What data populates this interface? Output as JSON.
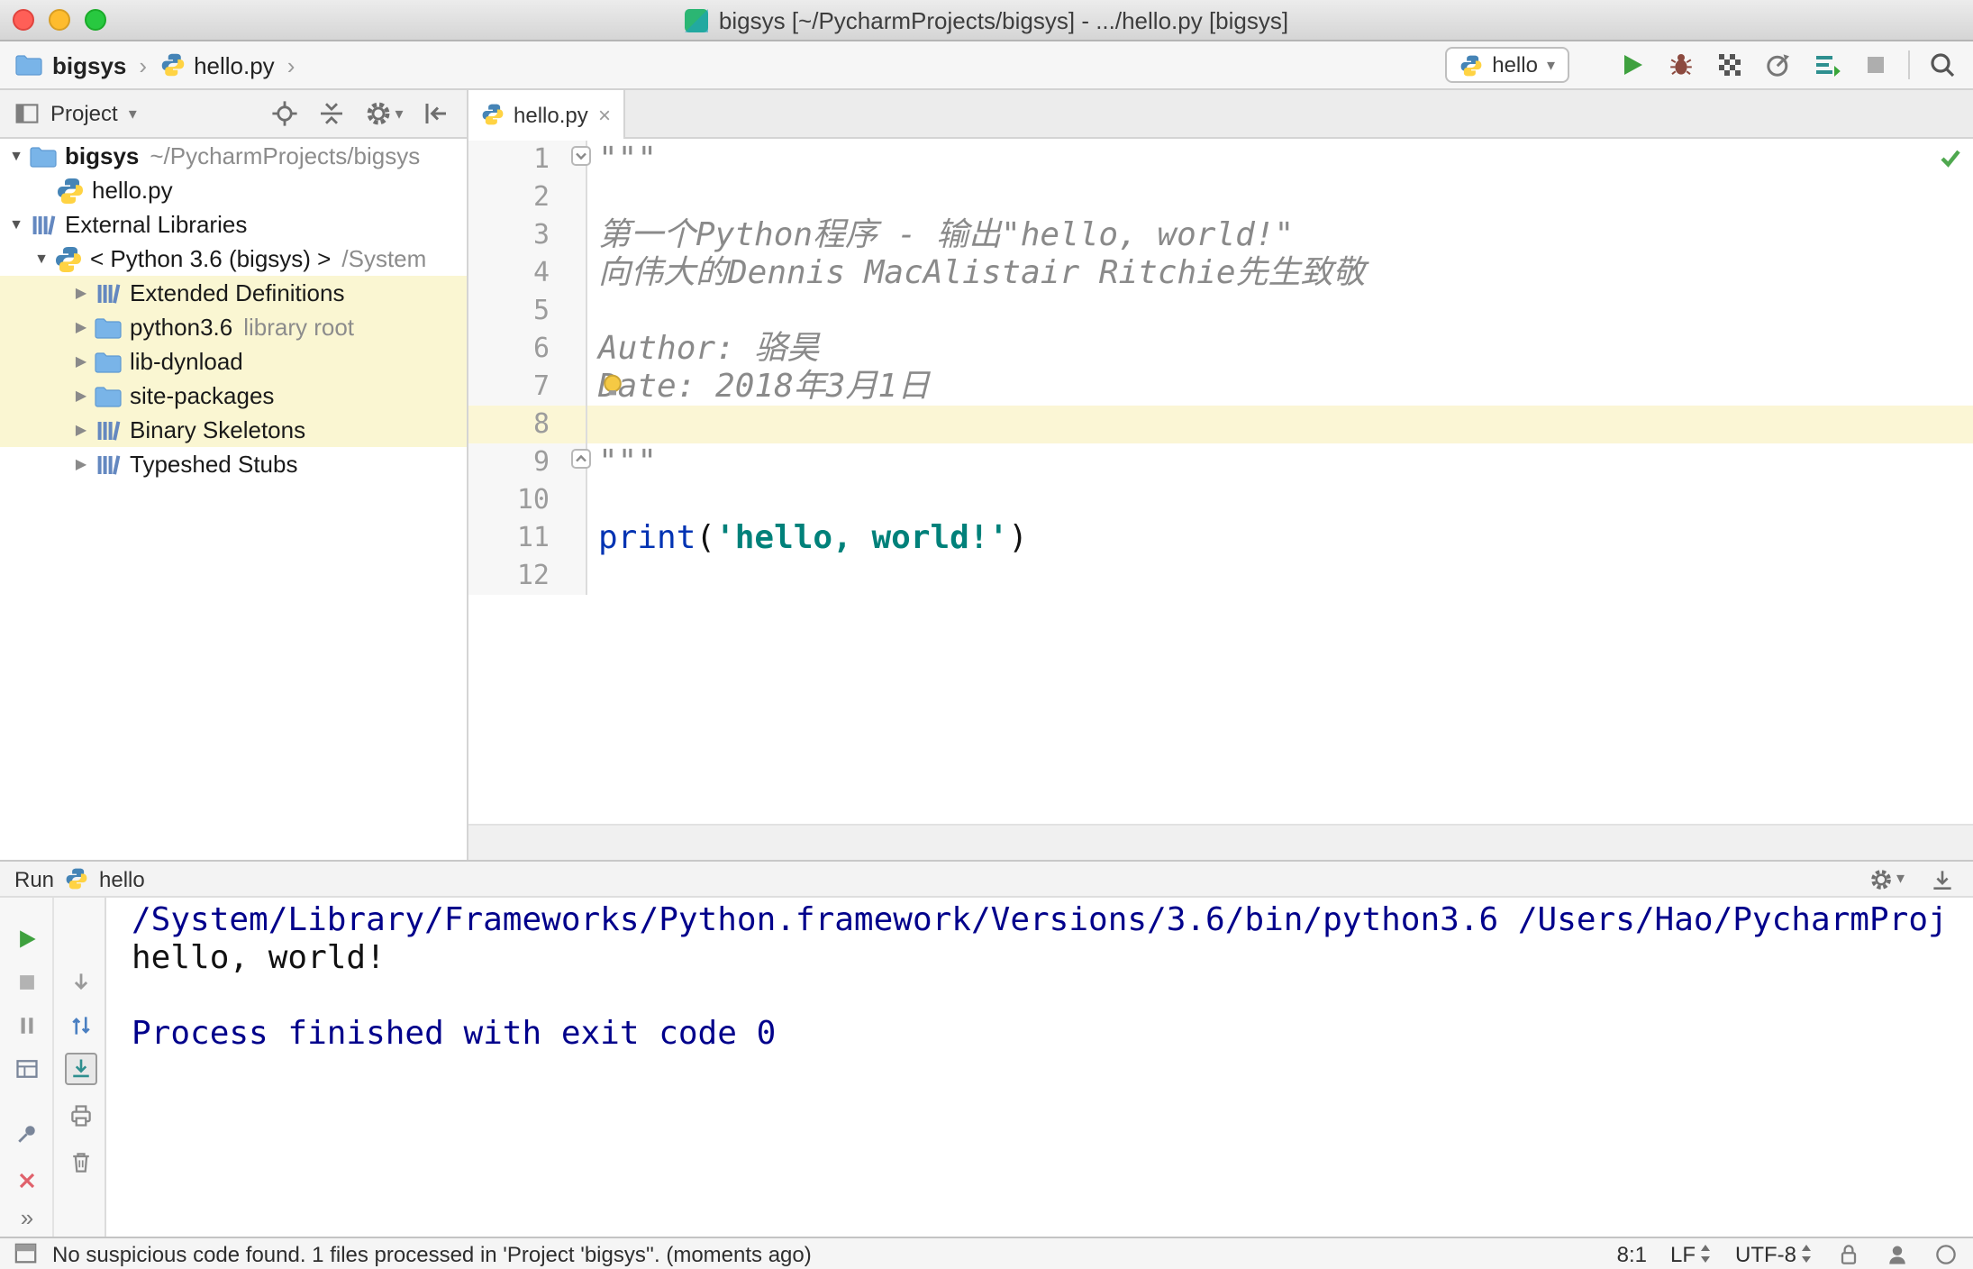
{
  "window": {
    "title": "bigsys [~/PycharmProjects/bigsys] - .../hello.py [bigsys]"
  },
  "glyphs": {
    "expanded": "▼",
    "collapsed": "▶",
    "separator": "›",
    "caret": "▾",
    "close": "×",
    "more": "»"
  },
  "navbar": {
    "breadcrumb": {
      "project": "bigsys",
      "file": "hello.py"
    },
    "run_config": {
      "name": "hello"
    }
  },
  "project_panel": {
    "title": "Project",
    "tree": [
      {
        "label": "bigsys",
        "suffix": "~/PycharmProjects/bigsys"
      },
      {
        "label": "hello.py"
      },
      {
        "label": "External Libraries"
      },
      {
        "label": "< Python 3.6 (bigsys) >",
        "suffix": "/System"
      },
      {
        "label": "Extended Definitions"
      },
      {
        "label": "python3.6",
        "suffix": "library root"
      },
      {
        "label": "lib-dynload"
      },
      {
        "label": "site-packages"
      },
      {
        "label": "Binary Skeletons"
      },
      {
        "label": "Typeshed Stubs"
      }
    ]
  },
  "editor": {
    "tab": "hello.py",
    "line_numbers": [
      "1",
      "2",
      "3",
      "4",
      "5",
      "6",
      "7",
      "8",
      "9",
      "10",
      "11",
      "12"
    ],
    "doc": {
      "l1": "\"\"\"",
      "l3": "第一个Python程序 - 输出\"hello, world!\"",
      "l4": "向伟大的Dennis MacAlistair Ritchie先生致敬",
      "l6": "Author: 骆昊",
      "l7": "Date: 2018年3月1日",
      "l9": "\"\"\""
    },
    "code": {
      "func": "print",
      "open": "(",
      "string": "'hello, world!'",
      "close": ")"
    }
  },
  "run_panel": {
    "title": "Run",
    "config": "hello",
    "console": {
      "line1": "/System/Library/Frameworks/Python.framework/Versions/3.6/bin/python3.6 /Users/Hao/PycharmProj",
      "line2": "hello, world!",
      "line4": "Process finished with exit code 0"
    }
  },
  "statusbar": {
    "message": "No suspicious code found. 1 files processed in 'Project 'bigsys''. (moments ago)",
    "caret_position": "8:1",
    "line_separator": "LF",
    "encoding": "UTF-8"
  },
  "colors": {
    "run_green": "#3fa13f",
    "keyword": "#0033b3",
    "string": "#00817a",
    "console_info": "#00008b",
    "caret_line": "#fbf6d5",
    "tree_highlight": "#faf6d2",
    "inspection_ok": "#4fa84f"
  }
}
